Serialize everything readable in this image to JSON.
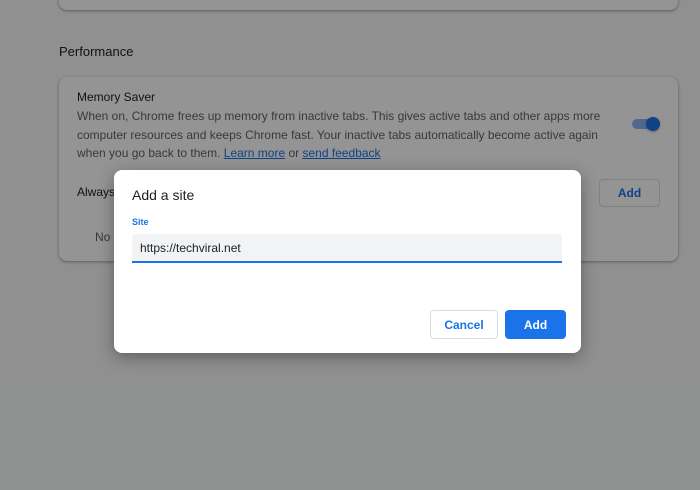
{
  "performance": {
    "section_title": "Performance",
    "memory_saver": {
      "title": "Memory Saver",
      "description": "When on, Chrome frees up memory from inactive tabs. This gives active tabs and other apps more computer resources and keeps Chrome fast. Your inactive tabs automatically become active again when you go back to them.",
      "learn_more": "Learn more",
      "or_text": "or",
      "send_feedback": "send feedback",
      "toggle_on": true
    },
    "always_active_label": "Always",
    "no_sites_label": "No",
    "add_button": "Add"
  },
  "dialog": {
    "title": "Add a site",
    "field_label": "Site",
    "site_value": "https://techviral.net",
    "cancel_label": "Cancel",
    "add_label": "Add"
  },
  "colors": {
    "accent": "#1a73e8",
    "toggle_track": "#8ab4f8",
    "scrim": "rgba(0,0,0,0.42)"
  }
}
